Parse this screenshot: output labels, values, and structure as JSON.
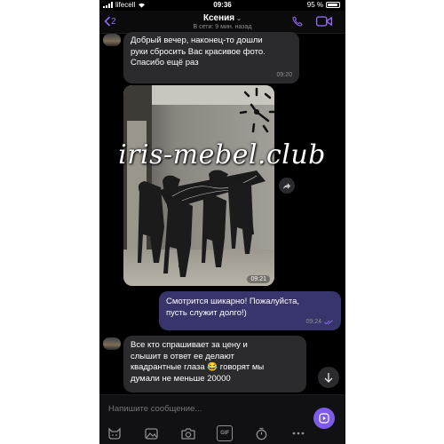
{
  "status_bar": {
    "carrier": "lifecell",
    "time": "09:36",
    "battery": "95 %"
  },
  "header": {
    "back_count": "2",
    "contact_name": "Ксения",
    "last_seen": "В сети: 9 мин. назад"
  },
  "messages": [
    {
      "direction": "incoming",
      "text": "Добрый вечер, наконец-то дошли\nруки сбросить Вас красивое фото.\nСпасибо ещё раз",
      "time": "09:20"
    },
    {
      "direction": "incoming",
      "type": "photo",
      "time": "09:21"
    },
    {
      "direction": "outgoing",
      "text": "Смотрится шикарно! Пожалуйста,\nпусть служит долго!)",
      "time": "09:24"
    },
    {
      "direction": "incoming",
      "text": "Все кто спрашивает за цену и\nслышит в ответ ее делают\nквадрантные глаза 😂 говорят мы\nдумали не меньше 20000"
    }
  ],
  "watermark": "iris-mebel.club",
  "composer": {
    "placeholder": "Напишите сообщение...",
    "gif_label": "GIF"
  },
  "colors": {
    "accent": "#8f6bf0",
    "incoming_bubble": "#2b2b2e",
    "outgoing_bubble": "#37356c",
    "background": "#000000"
  }
}
